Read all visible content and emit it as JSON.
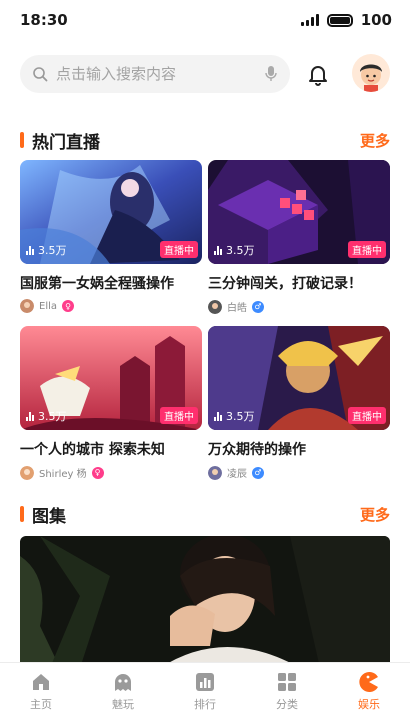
{
  "status_bar": {
    "time": "18:30",
    "battery": "100"
  },
  "search": {
    "placeholder": "点击输入搜索内容"
  },
  "live_section": {
    "title": "热门直播",
    "more": "更多"
  },
  "live_cards": [
    {
      "viewers": "3.5万",
      "badge": "直播中",
      "title": "国服第一女娲全程骚操作",
      "streamer": "Ella",
      "badge_icon": "female-icon"
    },
    {
      "viewers": "3.5万",
      "badge": "直播中",
      "title": "三分钟闯关，打破记录！",
      "streamer": "白皓",
      "badge_icon": "male-icon"
    },
    {
      "viewers": "3.5万",
      "badge": "直播中",
      "title": "一个人的城市 探索未知",
      "streamer": "Shirley 杨",
      "badge_icon": "female-icon"
    },
    {
      "viewers": "3.5万",
      "badge": "直播中",
      "title": "万众期待的操作",
      "streamer": "凌辰",
      "badge_icon": "male-icon"
    }
  ],
  "album_section": {
    "title": "图集",
    "more": "更多"
  },
  "tabs": [
    {
      "label": "主页",
      "icon": "home-icon",
      "active": false
    },
    {
      "label": "魅玩",
      "icon": "ghost-icon",
      "active": false
    },
    {
      "label": "排行",
      "icon": "chart-icon",
      "active": false
    },
    {
      "label": "分类",
      "icon": "grid-icon",
      "active": false
    },
    {
      "label": "娱乐",
      "icon": "pacman-icon",
      "active": true
    }
  ],
  "colors": {
    "accent": "#ff6a1a",
    "live_badge": "#ff2f6e",
    "female": "#ff3d8b",
    "male": "#3d8bff"
  }
}
